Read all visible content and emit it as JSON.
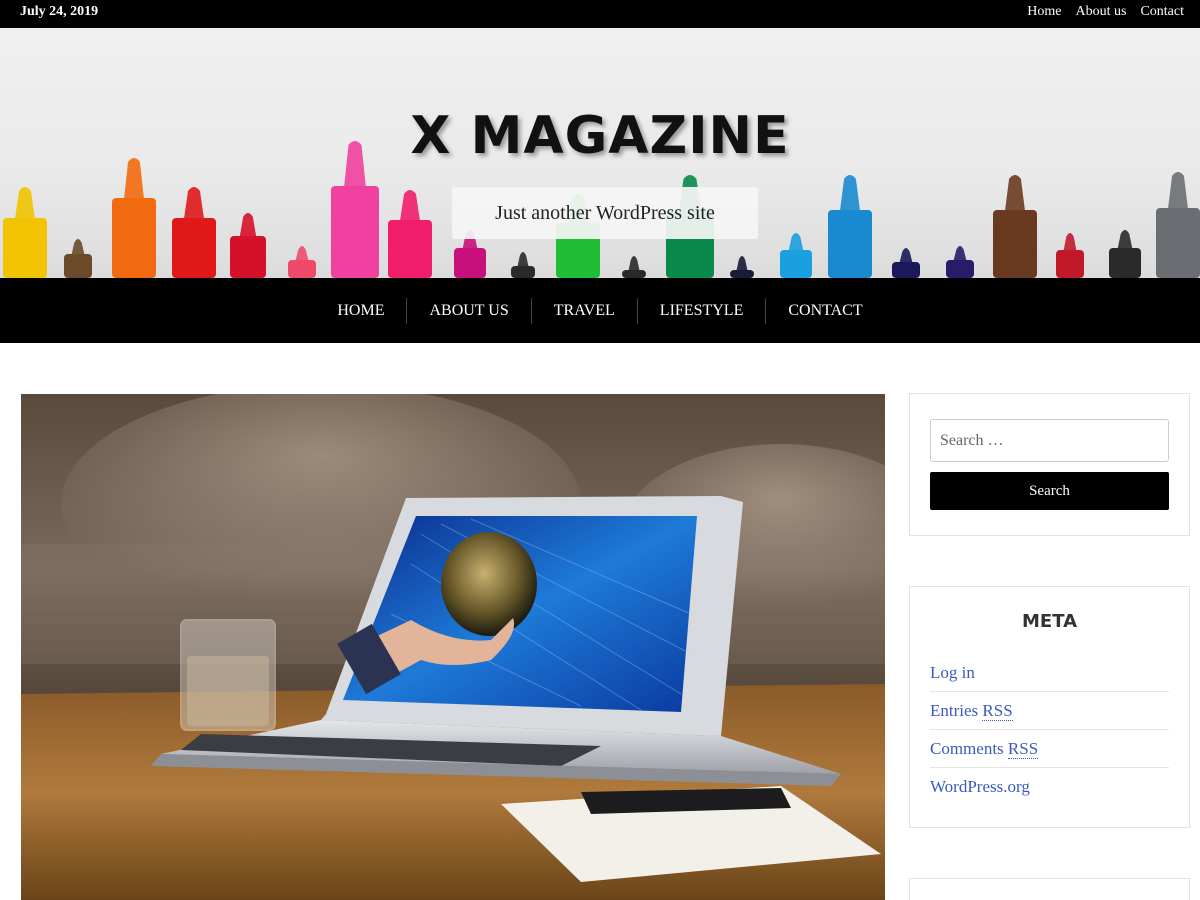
{
  "topbar": {
    "date": "July 24, 2019",
    "links": [
      "Home",
      "About us",
      "Contact"
    ]
  },
  "header": {
    "site_title": "X MAGAZINE",
    "tagline": "Just another WordPress site"
  },
  "nav": {
    "items": [
      "HOME",
      "ABOUT US",
      "TRAVEL",
      "LIFESTYLE",
      "CONTACT"
    ]
  },
  "search": {
    "placeholder": "Search …",
    "button_label": "Search"
  },
  "meta": {
    "title": "META",
    "links": [
      {
        "pre": "Log in",
        "abbr": ""
      },
      {
        "pre": "Entries ",
        "abbr": "RSS"
      },
      {
        "pre": "Comments ",
        "abbr": "RSS"
      },
      {
        "pre": "WordPress.org",
        "abbr": ""
      }
    ]
  },
  "colors": {
    "bar_bg": "#000000",
    "link": "#3a5bbd"
  },
  "icons": {
    "featured_image": "laptop-globe-photo",
    "header_image": "colored-markers-photo"
  }
}
